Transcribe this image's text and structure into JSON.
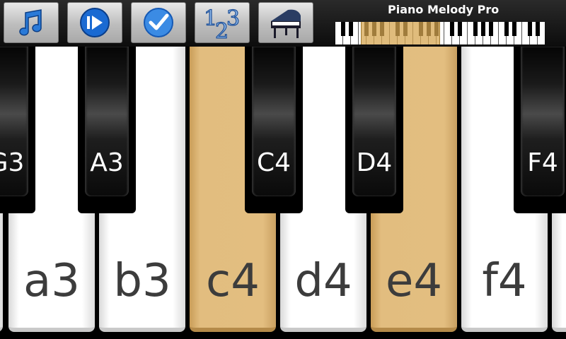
{
  "app": {
    "title": "Piano Melody Pro"
  },
  "toolbar": {
    "buttons": [
      {
        "name": "music-note-button",
        "icon": "music-note-icon"
      },
      {
        "name": "play-button",
        "icon": "play-icon"
      },
      {
        "name": "check-button",
        "icon": "check-icon"
      },
      {
        "name": "numbers-button",
        "icon": "numbers-123-icon"
      },
      {
        "name": "piano-button",
        "icon": "grand-piano-icon"
      }
    ]
  },
  "colors": {
    "highlight": "#e3be80",
    "accent_blue": "#1e6fd0"
  },
  "keyboard": {
    "white_keys": [
      {
        "label": "",
        "highlighted": false
      },
      {
        "label": "a3",
        "highlighted": false
      },
      {
        "label": "b3",
        "highlighted": false
      },
      {
        "label": "c4",
        "highlighted": true
      },
      {
        "label": "d4",
        "highlighted": false
      },
      {
        "label": "e4",
        "highlighted": true
      },
      {
        "label": "f4",
        "highlighted": false
      },
      {
        "label": "",
        "highlighted": false
      }
    ],
    "black_keys": [
      {
        "label": "G3"
      },
      {
        "label": "A3"
      },
      {
        "label": "C4"
      },
      {
        "label": "D4"
      },
      {
        "label": "F4"
      }
    ]
  }
}
